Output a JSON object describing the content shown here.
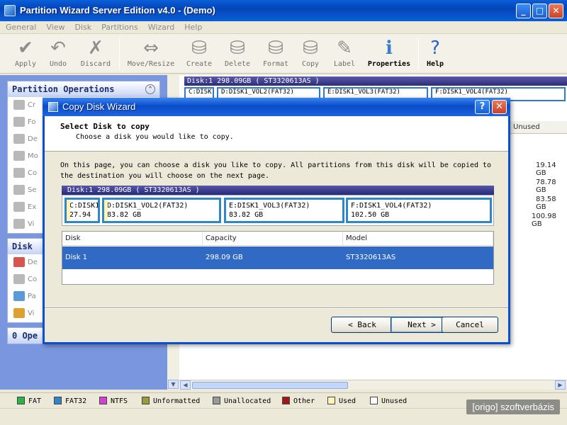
{
  "window": {
    "title": "Partition Wizard Server Edition v4.0 - (Demo)",
    "min": "_",
    "max": "□",
    "close": "✕"
  },
  "menu": [
    "General",
    "View",
    "Disk",
    "Partitions",
    "Wizard",
    "Help"
  ],
  "toolbar": {
    "apply": "Apply",
    "undo": "Undo",
    "discard": "Discard",
    "move_resize": "Move/Resize",
    "create": "Create",
    "delete": "Delete",
    "format": "Format",
    "copy": "Copy",
    "label": "Label",
    "properties": "Properties",
    "help": "Help"
  },
  "left_panel": {
    "partition_ops_title": "Partition Operations",
    "partition_items": [
      "Cr",
      "Fo",
      "De",
      "Mo",
      "Co",
      "Se",
      "Ex",
      "Vi"
    ],
    "disk_title": "Disk",
    "disk_items": [
      "De",
      "Co",
      "Pa",
      "Vi"
    ],
    "ops_title": "0 Ope"
  },
  "main_map": {
    "disk_bar": "Disk:1 298.09GB  ( ST3320613AS )",
    "parts": [
      "C:DISK",
      "D:DISK1_VOL2(FAT32)",
      "E:DISK1_VOL3(FAT32)",
      "F:DISK1_VOL4(FAT32)"
    ],
    "unused_header": "Unused",
    "unused_values": [
      "19.14 GB",
      "78.78 GB",
      "83.58 GB",
      "100.98 GB"
    ]
  },
  "legend": {
    "items": [
      {
        "label": "FAT",
        "color": "#2bb34a"
      },
      {
        "label": "FAT32",
        "color": "#2e86c8"
      },
      {
        "label": "NTFS",
        "color": "#d63fd6"
      },
      {
        "label": "Unformatted",
        "color": "#9c9a3a"
      },
      {
        "label": "Unallocated",
        "color": "#9a9a9a"
      },
      {
        "label": "Other",
        "color": "#a01818"
      },
      {
        "label": "Used",
        "color": "#fff6b8"
      },
      {
        "label": "Unused",
        "color": "#ffffff"
      }
    ]
  },
  "watermark": "[origo] szoftverbázis",
  "dialog": {
    "title": "Copy Disk Wizard",
    "help": "?",
    "close": "✕",
    "header_title": "Select Disk to copy",
    "header_sub": "Choose a disk you would like to copy.",
    "desc_line1": "On this page, you can choose a disk you like to copy. All partitions from this disk will be copied to",
    "desc_line2": "the destination you will choose on the next page.",
    "disk_bar": "Disk:1 298.09GB  ( ST3320613AS )",
    "partitions": [
      {
        "name": "C:DISK1",
        "size": "27.94 G"
      },
      {
        "name": "D:DISK1_VOL2(FAT32)",
        "size": "83.82 GB"
      },
      {
        "name": "E:DISK1_VOL3(FAT32)",
        "size": "83.82 GB"
      },
      {
        "name": "F:DISK1_VOL4(FAT32)",
        "size": "102.50 GB"
      }
    ],
    "table": {
      "headers": [
        "Disk",
        "Capacity",
        "Model"
      ],
      "rows": [
        {
          "disk": "Disk 1",
          "capacity": "298.09 GB",
          "model": "ST3320613AS"
        }
      ]
    },
    "buttons": {
      "back": "< Back",
      "next": "Next >",
      "cancel": "Cancel"
    }
  }
}
